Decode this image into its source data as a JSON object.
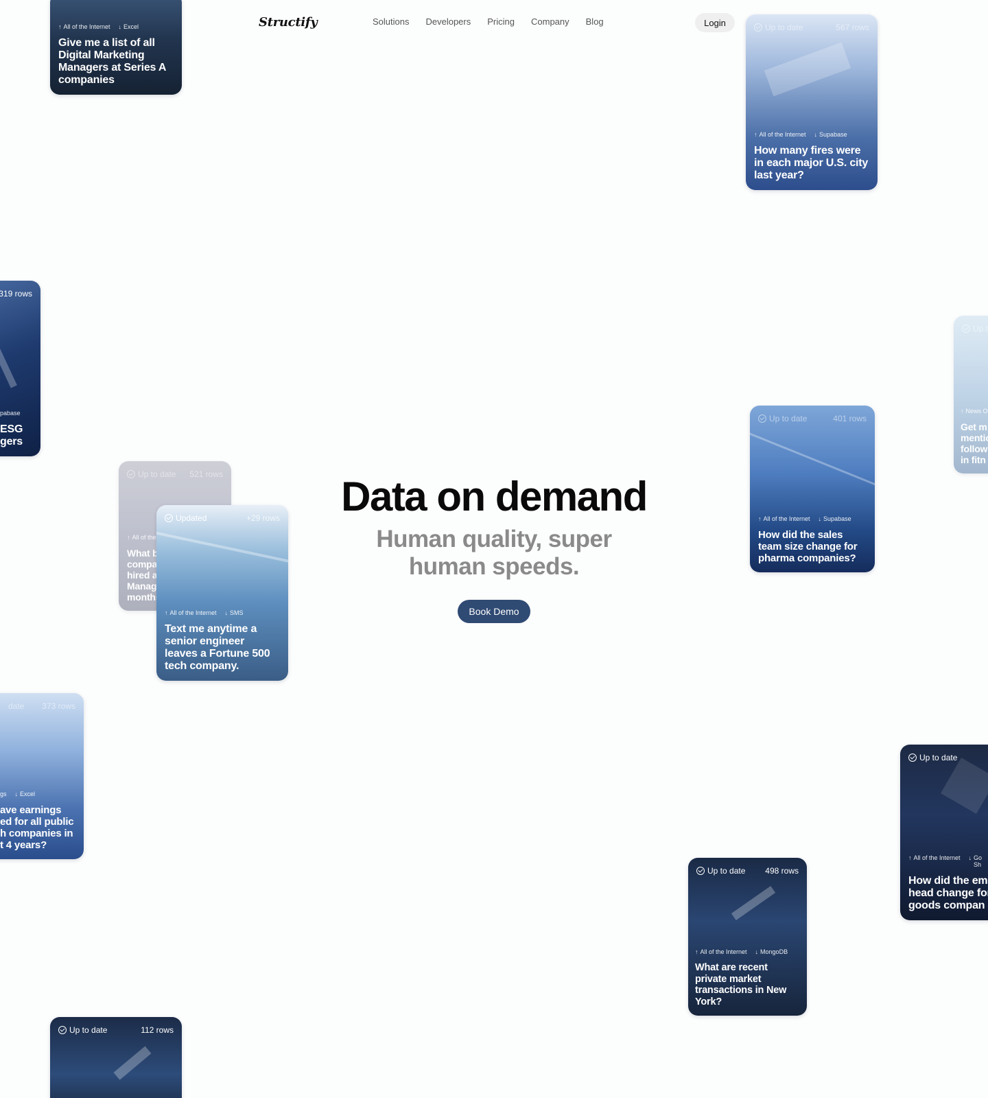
{
  "header": {
    "logo": "Structify",
    "nav": [
      "Solutions",
      "Developers",
      "Pricing",
      "Company",
      "Blog"
    ],
    "login": "Login"
  },
  "hero": {
    "title": "Data on demand",
    "subtitle": "Human quality, super human speeds.",
    "cta": "Book Demo"
  },
  "cards": [
    {
      "status": "",
      "rows": "",
      "src_from": "All of the Internet",
      "src_to": "Excel",
      "question": "Give me a list of all Digital Marketing Managers at Series A companies"
    },
    {
      "status": "Up to date",
      "rows": "567 rows",
      "src_from": "All of the Internet",
      "src_to": "Supabase",
      "question": "How many fires were in each major U.S. city last year?"
    },
    {
      "status": "",
      "rows": "319 rows",
      "src_from": "",
      "src_to": "pabase",
      "question": "ESG\ngers"
    },
    {
      "status": "Up t",
      "rows": "",
      "src_from": "News O",
      "src_to": "",
      "question": "Get m\nmentic\nfollow\nin fitn"
    },
    {
      "status": "Up to date",
      "rows": "401 rows",
      "src_from": "All of the Internet",
      "src_to": "Supabase",
      "question": "How did the sales team size change for pharma companies?"
    },
    {
      "status": "Up to date",
      "rows": "521 rows",
      "src_from": "All of the",
      "src_to": "",
      "question": "What b\ncompa\nhired a\nManag\nmonths"
    },
    {
      "status": "Updated",
      "rows": "+29 rows",
      "src_from": "All of the Internet",
      "src_to": "SMS",
      "question": "Text me anytime a senior engineer leaves a Fortune 500 tech company."
    },
    {
      "status": "date",
      "rows": "373 rows",
      "src_from": "gs",
      "src_to": "Excel",
      "question": "ave earnings\ned for all public\nh companies in\nt 4 years?"
    },
    {
      "status": "Up to date",
      "rows": "",
      "src_from": "All of the Internet",
      "src_to": "Go\nSh",
      "question": "How did the employee head change for con goods compan"
    },
    {
      "status": "Up to date",
      "rows": "498 rows",
      "src_from": "All of the Internet",
      "src_to": "MongoDB",
      "question": "What are recent private market transactions in New York?"
    },
    {
      "status": "Up to date",
      "rows": "112 rows",
      "src_from": "",
      "src_to": "",
      "question": ""
    }
  ]
}
